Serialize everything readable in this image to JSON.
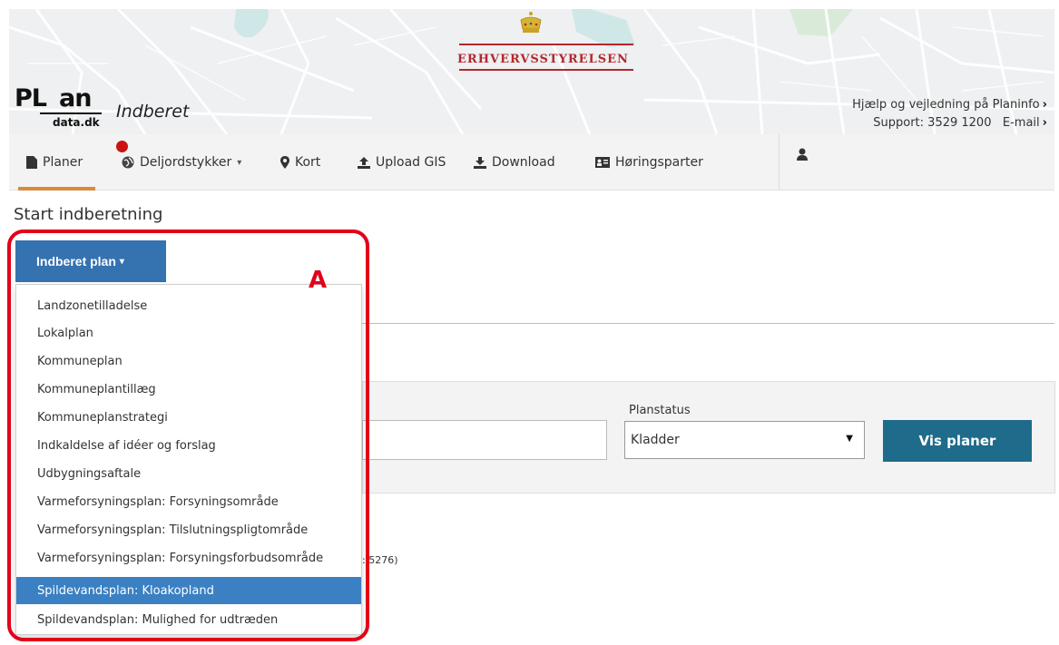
{
  "header": {
    "agency_name": "Erhvervsstyrelsen",
    "logo_pl": "PL",
    "logo_an": "an",
    "logo_sub": "data.dk",
    "app_title": "Indberet",
    "help_link": "Hjælp og vejledning på Planinfo",
    "support_label": "Support: 3529 1200",
    "email_link": "E-mail",
    "colors": {
      "agency_red": "#b3282d",
      "map_bg": "#eef0f1",
      "map_water": "#cfe7e6"
    }
  },
  "nav": {
    "items": [
      {
        "label": "Planer",
        "icon": "document-icon",
        "active": true
      },
      {
        "label": "Deljordstykker",
        "icon": "globe-icon",
        "has_caret": true,
        "has_notification": true
      },
      {
        "label": "Kort",
        "icon": "map-marker-icon"
      },
      {
        "label": "Upload GIS",
        "icon": "upload-icon"
      },
      {
        "label": "Download",
        "icon": "download-icon"
      },
      {
        "label": "Høringsparter",
        "icon": "contact-card-icon"
      }
    ],
    "user_icon": "user-icon",
    "active_color": "#d88a3f"
  },
  "main": {
    "page_title": "Start indberetning",
    "primary_button": "Indberet plan",
    "dropdown": {
      "items": [
        "Landzonetilladelse",
        "Lokalplan",
        "Kommuneplan",
        "Kommuneplantillæg",
        "Kommuneplanstrategi",
        "Indkaldelse af idéer og forslag",
        "Udbygningsaftale",
        "Varmeforsyningsplan: Forsyningsområde",
        "Varmeforsyningsplan: Tilslutningspligtområde",
        "Varmeforsyningsplan: Forsyningsforbudsområde",
        "Spildevandsplan: Kloakopland",
        "Spildevandsplan: Mulighed for udtræden"
      ],
      "selected_index": 10,
      "selected_color": "#3a80c3"
    },
    "filter": {
      "planstatus_label": "Planstatus",
      "planstatus_value": "Kladder",
      "search_button": "Vis planer",
      "text_value": ""
    },
    "count_text": ": 5276)"
  },
  "annotation": {
    "label": "A",
    "color": "#e3001b"
  }
}
